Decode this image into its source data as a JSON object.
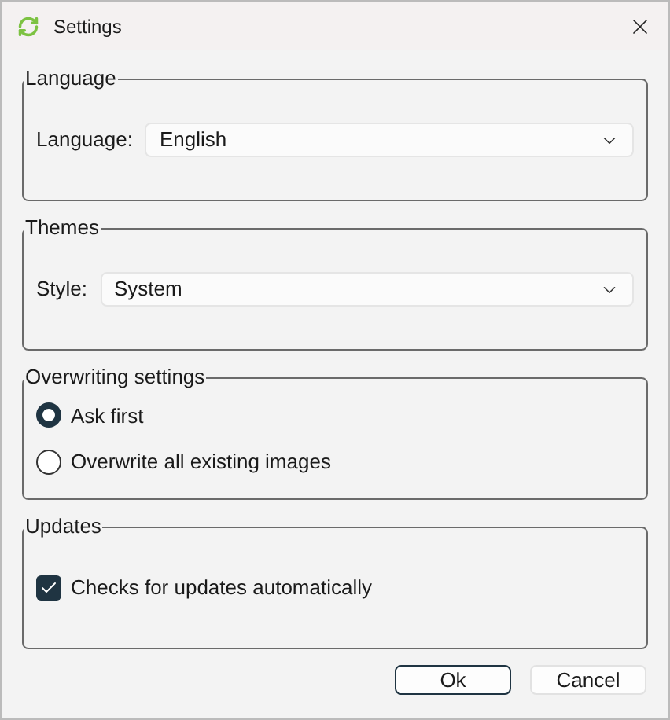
{
  "window": {
    "title": "Settings"
  },
  "groups": [
    {
      "title": "Language",
      "kind": "select",
      "label": "Language:",
      "value": "English"
    },
    {
      "title": "Themes",
      "kind": "select",
      "label": "Style:",
      "value": "System"
    },
    {
      "title": "Overwriting settings",
      "kind": "radios",
      "options": [
        {
          "label": "Ask first",
          "selected": true
        },
        {
          "label": "Overwrite all existing images",
          "selected": false
        }
      ]
    },
    {
      "title": "Updates",
      "kind": "checkbox",
      "label": "Checks for updates automatically",
      "checked": true
    }
  ],
  "buttons": [
    {
      "label": "Ok",
      "default": true
    },
    {
      "label": "Cancel",
      "default": false
    }
  ]
}
